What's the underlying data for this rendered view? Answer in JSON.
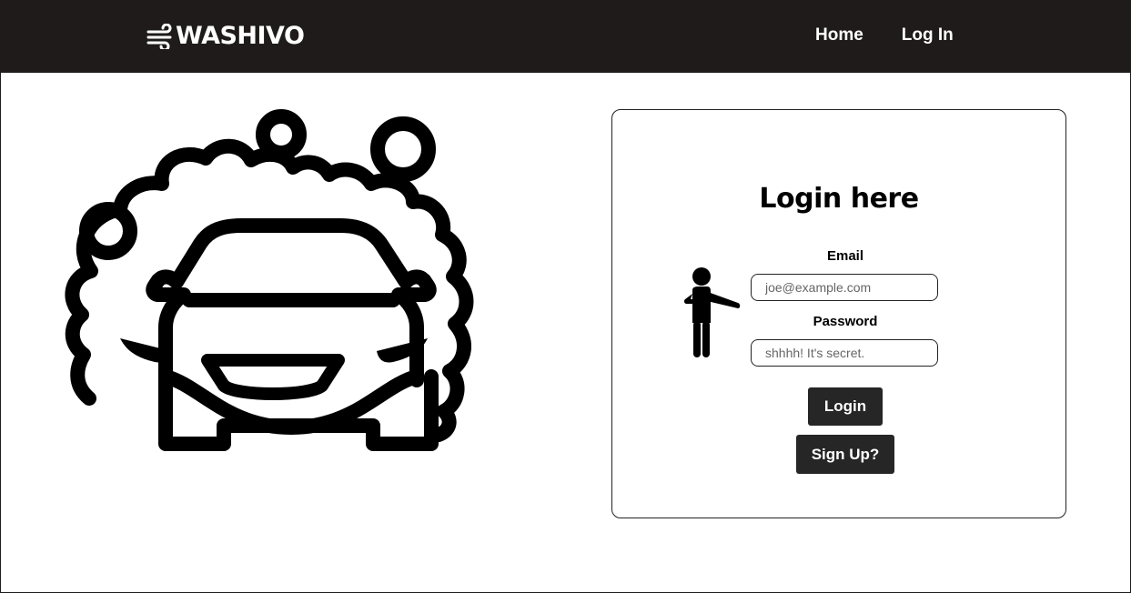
{
  "navbar": {
    "brand": {
      "icon": "wind-icon",
      "name": "WASHIVO"
    },
    "links": [
      {
        "label": "Home"
      },
      {
        "label": "Log In"
      }
    ]
  },
  "hero": {
    "icon": "car-wash-icon"
  },
  "login_card": {
    "title": "Login here",
    "illustration": "pointing-person-icon",
    "email": {
      "label": "Email",
      "placeholder": "joe@example.com",
      "value": ""
    },
    "password": {
      "label": "Password",
      "placeholder": "shhhh! It's secret.",
      "value": ""
    },
    "login_button": "Login",
    "signup_button": "Sign Up?"
  },
  "colors": {
    "navbar_bg": "#1f1b1b",
    "button_bg": "#262626",
    "text": "#000000"
  }
}
